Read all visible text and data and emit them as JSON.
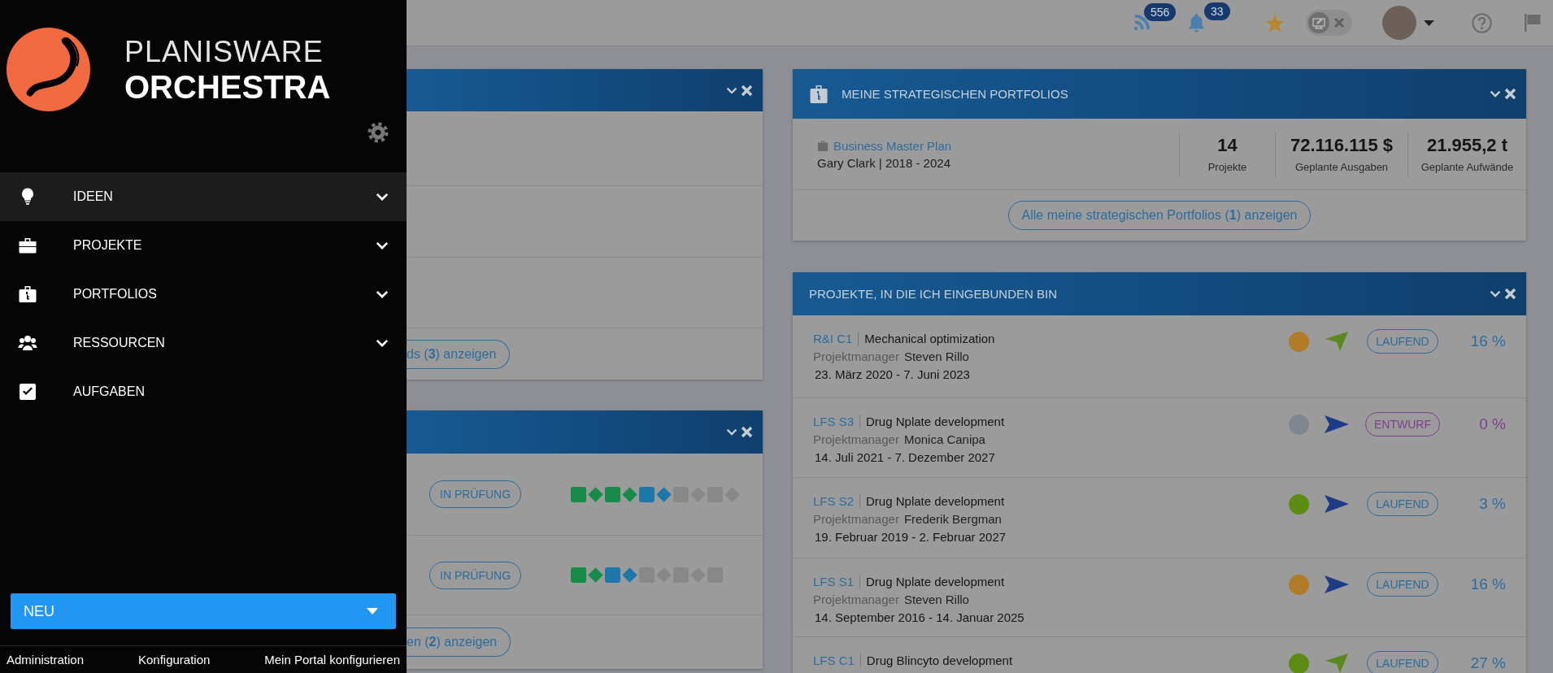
{
  "sidebar": {
    "logo": {
      "line1": "PLANISWARE",
      "line2": "ORCHESTRA"
    },
    "items": [
      {
        "kind": "bulb",
        "label": "IDEEN",
        "expandable": true,
        "selected": true
      },
      {
        "kind": "briefcase",
        "label": "PROJEKTE",
        "expandable": true,
        "selected": false
      },
      {
        "kind": "portfolio",
        "label": "PORTFOLIOS",
        "expandable": true,
        "selected": false
      },
      {
        "kind": "people",
        "label": "RESSOURCEN",
        "expandable": true,
        "selected": false
      },
      {
        "kind": "check",
        "label": "AUFGABEN",
        "expandable": false,
        "selected": false
      }
    ],
    "new_button": "NEU",
    "footer_links": [
      "Administration",
      "Konfiguration",
      "Mein Portal konfigurieren"
    ]
  },
  "top_bar": {
    "feed_count": "556",
    "notification_count": "33",
    "edit_mode_on": false
  },
  "upper_left_card": {
    "footer_button": "ds (**3**) anzeigen"
  },
  "lower_left_card": {
    "rows": [
      {
        "status": "IN PRÜFUNG",
        "milestones": [
          {
            "kind": "square",
            "color": "#178c49"
          },
          {
            "kind": "diamond",
            "color": "#178c49"
          },
          {
            "kind": "square",
            "color": "#178c49"
          },
          {
            "kind": "diamond",
            "color": "#178c49"
          },
          {
            "kind": "square",
            "color": "#1d77a9"
          },
          {
            "kind": "diamond",
            "color": "#1d77a9"
          },
          {
            "kind": "square",
            "color": "#888888"
          },
          {
            "kind": "diamond",
            "color": "#888888"
          },
          {
            "kind": "square",
            "color": "#888888"
          },
          {
            "kind": "diamond",
            "color": "#888888"
          }
        ]
      },
      {
        "status": "IN PRÜFUNG",
        "milestones": [
          {
            "kind": "square",
            "color": "#178c49"
          },
          {
            "kind": "diamond",
            "color": "#178c49"
          },
          {
            "kind": "square",
            "color": "#1d77a9"
          },
          {
            "kind": "diamond",
            "color": "#1d77a9"
          },
          {
            "kind": "square",
            "color": "#888888"
          },
          {
            "kind": "diamond",
            "color": "#888888"
          },
          {
            "kind": "square",
            "color": "#888888"
          },
          {
            "kind": "diamond",
            "color": "#888888"
          },
          {
            "kind": "square",
            "color": "#888888"
          }
        ]
      }
    ],
    "footer_button": "en (**2**) anzeigen"
  },
  "portfolio_card": {
    "title": "MEINE STRATEGISCHEN PORTFOLIOS",
    "portfolio": {
      "name": "Business Master Plan",
      "owner": "Gary Clark  | 2018 - 2024"
    },
    "stats": [
      {
        "value": "14",
        "label": "Projekte"
      },
      {
        "value": "72.116.115 $",
        "label": "Geplante Ausgaben"
      },
      {
        "value": "21.955,2 t",
        "label": "Geplante Aufwände"
      }
    ],
    "footer_button": "Alle meine strategischen Portfolios (**1**) anzeigen"
  },
  "projects_card": {
    "title": "PROJEKTE, IN DIE ICH EINGEBUNDEN BIN",
    "rows": [
      {
        "code": "R&I C1",
        "name": "Mechanical optimization",
        "manager_label": "Projektmanager",
        "manager": "Steven Rillo",
        "dates": "23. März 2020 - 7. Juni 2023",
        "health": {
          "color": "#b07c2a"
        },
        "trend": {
          "kind": "up",
          "color": "#5a8a1e"
        },
        "status": {
          "label": "LAUFEND",
          "kind": "running"
        },
        "percent": "16 %"
      },
      {
        "code": "LFS S3",
        "name": "Drug Nplate development",
        "manager_label": "Projektmanager",
        "manager": "Monica Canipa",
        "dates": "14. Juli 2021 - 7. Dezember 2027",
        "health": {
          "color": "#7e8790"
        },
        "trend": {
          "kind": "right",
          "color": "#1e3b87"
        },
        "status": {
          "label": "ENTWURF",
          "kind": "draft"
        },
        "percent": "0 %"
      },
      {
        "code": "LFS S2",
        "name": "Drug Nplate development",
        "manager_label": "Projektmanager",
        "manager": "Frederik Bergman",
        "dates": "19. Februar 2019 - 2. Februar 2027",
        "health": {
          "color": "#5c8c12"
        },
        "trend": {
          "kind": "right",
          "color": "#1e3b87"
        },
        "status": {
          "label": "LAUFEND",
          "kind": "running"
        },
        "percent": "3 %"
      },
      {
        "code": "LFS S1",
        "name": "Drug Nplate development",
        "manager_label": "Projektmanager",
        "manager": "Steven Rillo",
        "dates": "14. September 2016 - 14. Januar 2025",
        "health": {
          "color": "#b07c2a"
        },
        "trend": {
          "kind": "right",
          "color": "#1e3b87"
        },
        "status": {
          "label": "LAUFEND",
          "kind": "running"
        },
        "percent": "16 %"
      },
      {
        "code": "LFS C1",
        "name": "Drug Blincyto development",
        "health": {
          "color": "#5c8c12"
        },
        "trend": {
          "kind": "up",
          "color": "#5a8a1e"
        },
        "status": {
          "label": "LAUFEND",
          "kind": "running"
        },
        "percent": "27 %"
      }
    ]
  }
}
